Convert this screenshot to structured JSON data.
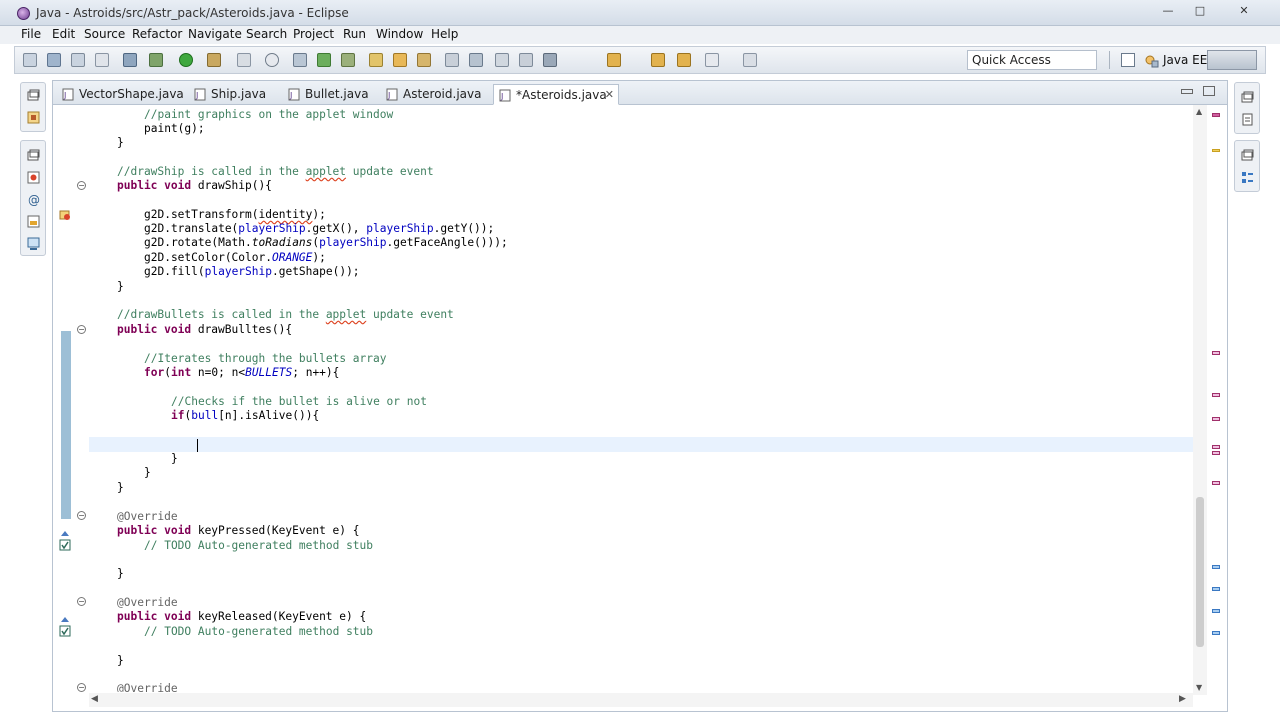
{
  "window": {
    "title": "Java - Astroids/src/Astr_pack/Asteroids.java - Eclipse",
    "controls": {
      "minimize": "—",
      "maximize": "□",
      "close": "✕"
    }
  },
  "menu": [
    "File",
    "Edit",
    "Source",
    "Refactor",
    "Navigate",
    "Search",
    "Project",
    "Run",
    "Window",
    "Help"
  ],
  "toolbar": {
    "quick_access": "Quick Access",
    "perspective": "Java EE"
  },
  "tabs": [
    {
      "label": "VectorShape.java"
    },
    {
      "label": "Ship.java"
    },
    {
      "label": "Bullet.java"
    },
    {
      "label": "Asteroid.java"
    },
    {
      "label": "*Asteroids.java",
      "active": true
    }
  ],
  "code": {
    "l01": "//paint graphics on the applet window",
    "l02": "paint(g);",
    "l03": "}",
    "l05a": "//drawShip is called in the ",
    "l05b": "applet",
    "l05c": " update event",
    "l06_kw": "public void",
    "l06": " drawShip(){",
    "l08a": "g2D.setTransform(",
    "l08b": "identity",
    "l08c": ");",
    "l09a": "g2D.translate(",
    "l09b": "playerShip",
    "l09c": ".getX(), ",
    "l09d": "playerShip",
    "l09e": ".getY());",
    "l10a": "g2D.rotate(Math.",
    "l10b": "toRadians",
    "l10c": "(",
    "l10d": "playerShip",
    "l10e": ".getFaceAngle()));",
    "l11a": "g2D.setColor(Color.",
    "l11b": "ORANGE",
    "l11c": ");",
    "l12a": "g2D.fill(",
    "l12b": "playerShip",
    "l12c": ".getShape());",
    "l13": "}",
    "l15a": "//drawBullets is called in the ",
    "l15b": "applet",
    "l15c": " update event",
    "l16_kw": "public void",
    "l16": " drawBulltes(){",
    "l18": "//Iterates through the bullets array",
    "l19_kw1": "for",
    "l19a": "(",
    "l19_kw2": "int",
    "l19b": " n=0; n<",
    "l19c": "BULLETS",
    "l19d": "; n++){",
    "l21": "//Checks if the bullet is alive or not",
    "l22_kw": "if",
    "l22a": "(",
    "l22b": "bull",
    "l22c": "[n].isAlive()){",
    "l24": "}",
    "l25": "}",
    "l26": "}",
    "l28": "@Override",
    "l29_kw": "public void",
    "l29": " keyPressed(KeyEvent e) {",
    "l30": "// TODO Auto-generated method stub",
    "l32": "}",
    "l34": "@Override",
    "l35_kw": "public void",
    "l35": " keyReleased(KeyEvent e) {",
    "l36": "// TODO Auto-generated method stub",
    "l38": "}",
    "l40": "@Override"
  },
  "colors": {
    "keyword": "#7f0055",
    "comment": "#3f7f5f",
    "field": "#0000c0",
    "annotation": "#646464",
    "current_line": "#e8f2fe"
  }
}
